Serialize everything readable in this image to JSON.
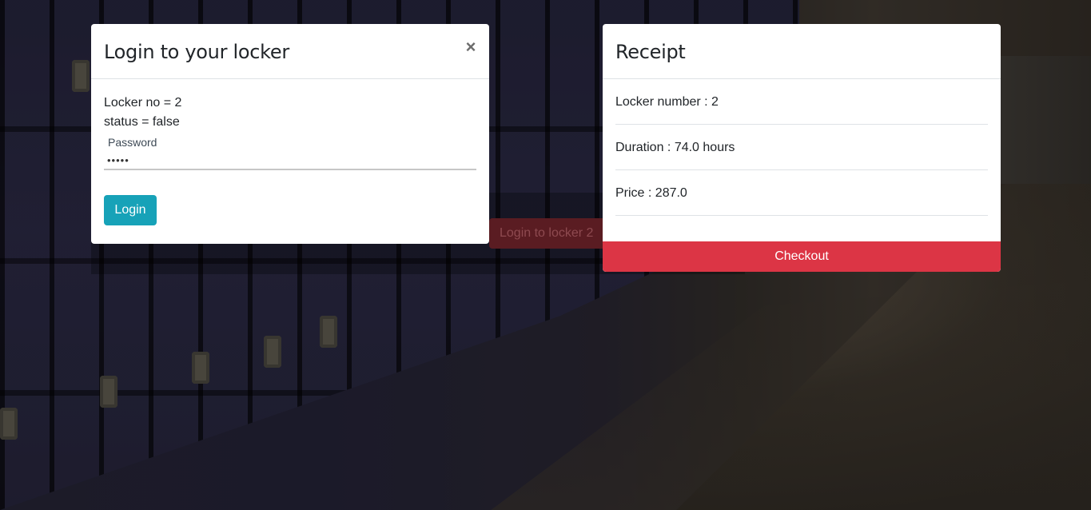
{
  "background": {
    "button_label": "Login to locker 2"
  },
  "login_modal": {
    "title": "Login to your locker",
    "close_symbol": "×",
    "locker_line": "Locker no = 2",
    "status_line": "status = false",
    "password_label": "Password",
    "password_value": "•••••",
    "login_button": "Login"
  },
  "receipt": {
    "title": "Receipt",
    "rows": [
      "Locker number : 2",
      "Duration : 74.0 hours",
      "Price : 287.0"
    ],
    "checkout_button": "Checkout"
  },
  "colors": {
    "login_button": "#17a2b8",
    "checkout_button": "#dc3545",
    "background_button": "#5a1c22"
  },
  "icons": {
    "close": "close-icon"
  }
}
